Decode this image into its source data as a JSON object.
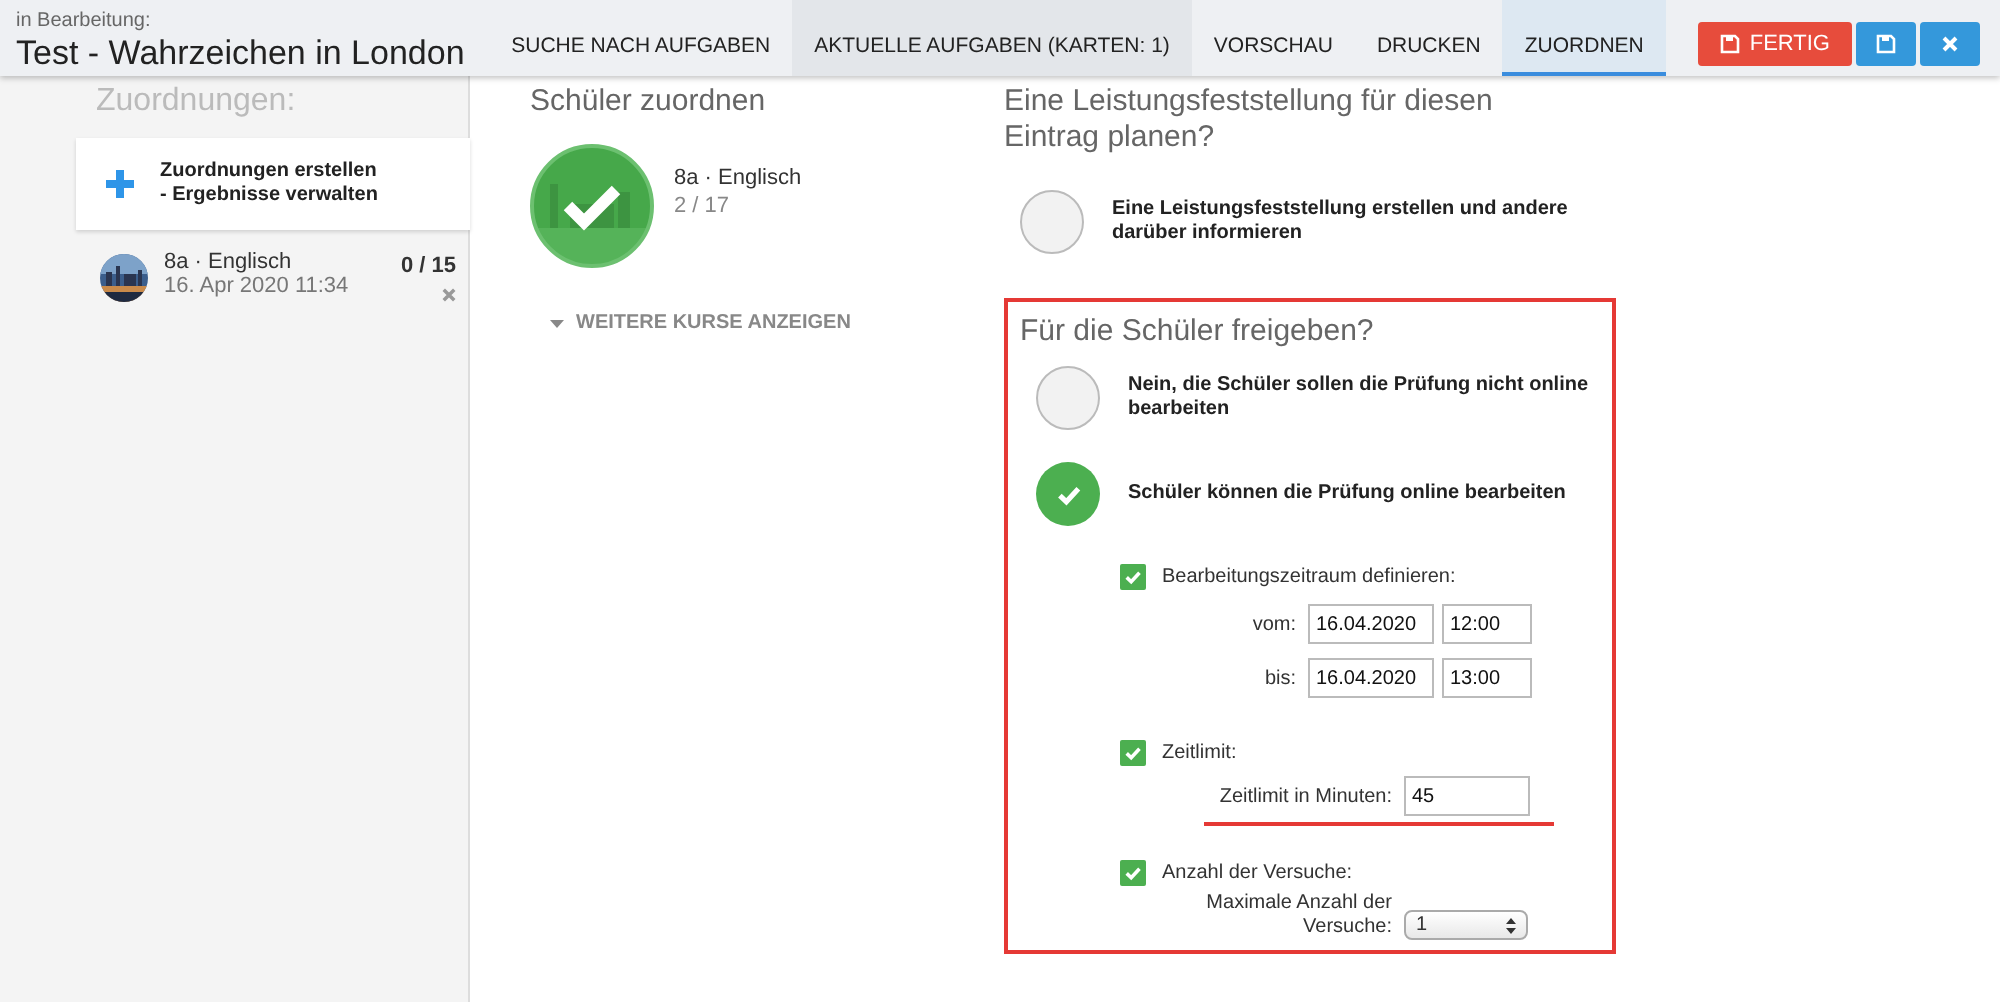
{
  "header": {
    "status_label": "in Bearbeitung:",
    "title": "Test - Wahrzeichen in London",
    "tabs": [
      {
        "label": "SUCHE NACH AUFGABEN",
        "selected": false
      },
      {
        "label": "AKTUELLE AUFGABEN (KARTEN: 1)",
        "selected": false
      },
      {
        "label": "VORSCHAU",
        "selected": false
      },
      {
        "label": "DRUCKEN",
        "selected": false
      },
      {
        "label": "ZUORDNEN",
        "selected": true
      }
    ],
    "buttons": [
      {
        "kind": "finish",
        "label": "FERTIG"
      },
      {
        "kind": "save"
      },
      {
        "kind": "close"
      }
    ]
  },
  "sidebar": {
    "heading": "Zuordnungen:",
    "create_item": {
      "line_1": "Zuordnungen erstellen",
      "line_2": "- Ergebnisse verwalten"
    },
    "entries": [
      {
        "course": "8a · Englisch",
        "date": "16. Apr 2020 11:34",
        "count": "0 / 15"
      }
    ]
  },
  "assign": {
    "heading": "Schüler zuordnen",
    "courses": [
      {
        "name": "8a · Englisch",
        "count": "2 / 17",
        "selected": true
      }
    ],
    "more_link": "WEITERE KURSE ANZEIGEN"
  },
  "assessment": {
    "heading": "Eine Leistungsfeststellung für diesen Eintrag planen?",
    "options": [
      {
        "label": "Eine Leistungsfeststellung erstellen und andere darüber informieren",
        "selected": false
      }
    ]
  },
  "release": {
    "heading": "Für die Schüler freigeben?",
    "options": [
      {
        "label": "Nein, die Schüler sollen die Prüfung nicht online bearbeiten",
        "selected": false
      },
      {
        "label": "Schüler können die Prüfung online bearbeiten",
        "selected": true
      }
    ],
    "settings": [
      {
        "kind": "period",
        "label": "Bearbeitungszeitraum definieren:",
        "checked": true,
        "rows": [
          {
            "label": "vom:",
            "date": "16.04.2020",
            "time": "12:00"
          },
          {
            "label": "bis:",
            "date": "16.04.2020",
            "time": "13:00"
          }
        ]
      },
      {
        "kind": "limit",
        "label": "Zeitlimit:",
        "checked": true,
        "field_label": "Zeitlimit in Minuten:",
        "value": "45"
      },
      {
        "kind": "attempts",
        "label": "Anzahl der Versuche:",
        "checked": true,
        "field_label": "Maximale Anzahl der Versuche:",
        "value": "1"
      }
    ]
  }
}
